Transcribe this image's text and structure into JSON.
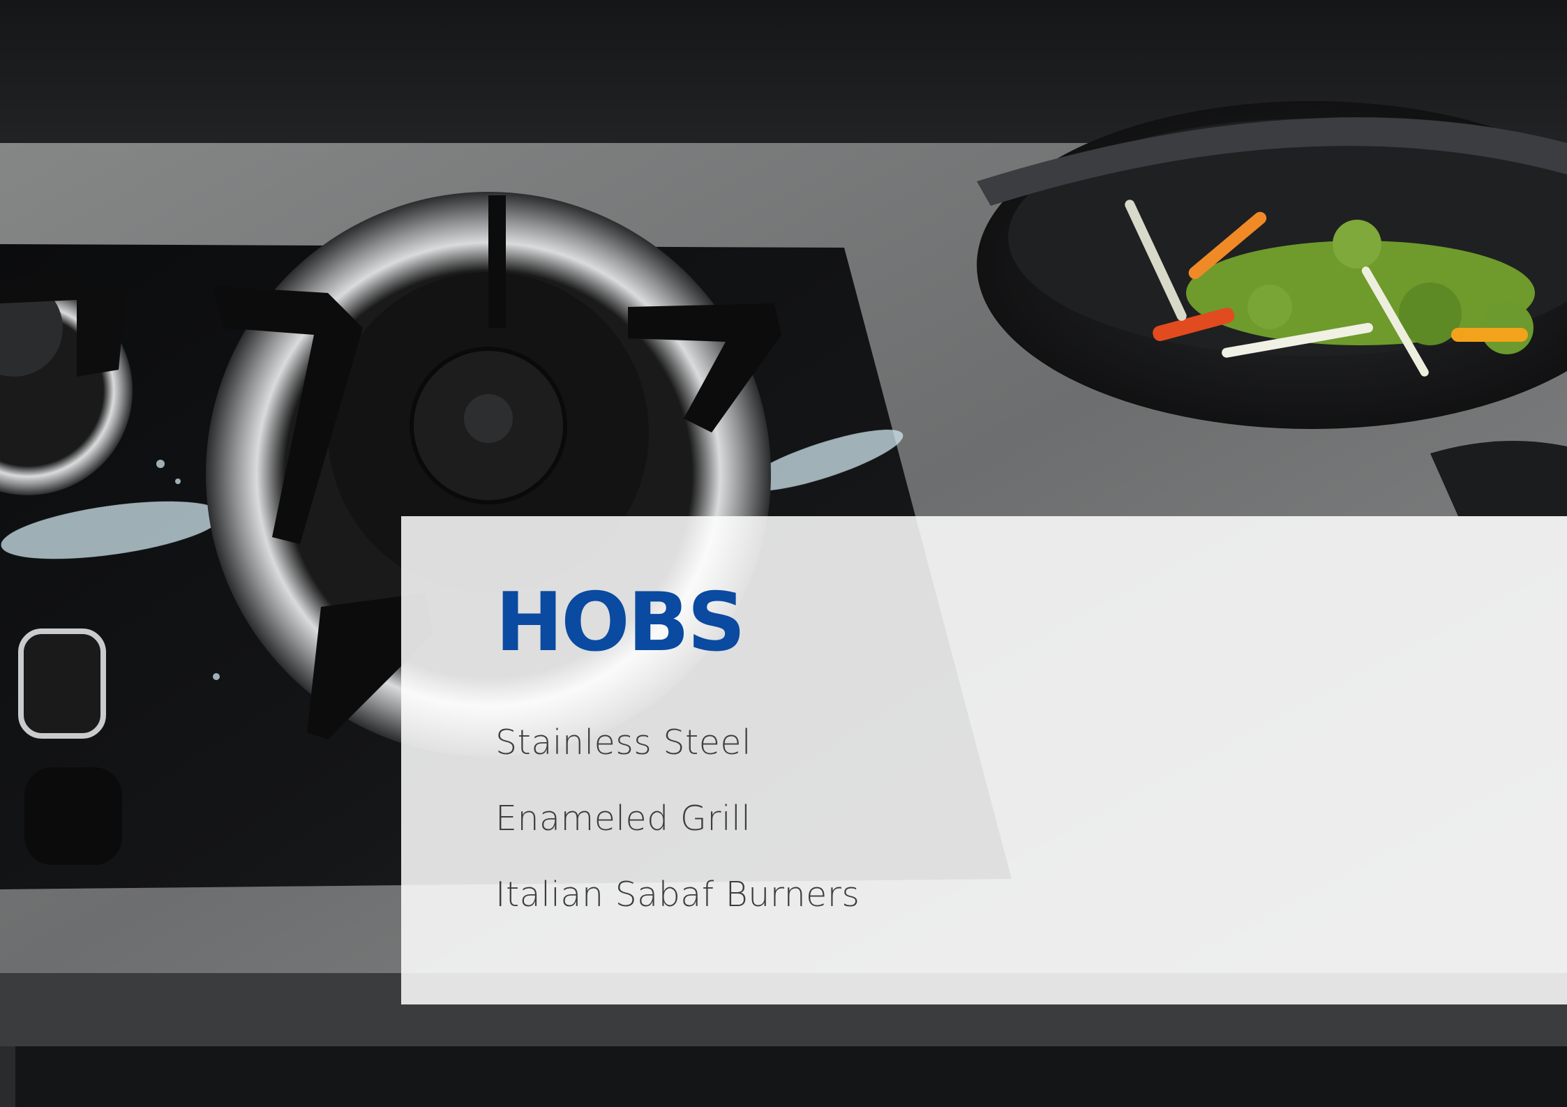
{
  "panel": {
    "title": "HOBS",
    "features": [
      "Stainless Steel",
      "Enameled Grill",
      "Italian Sabaf Burners"
    ]
  },
  "colors": {
    "title": "#0a4aa0",
    "feature_text": "#3d3d3d",
    "panel_background": "#ffffff"
  }
}
